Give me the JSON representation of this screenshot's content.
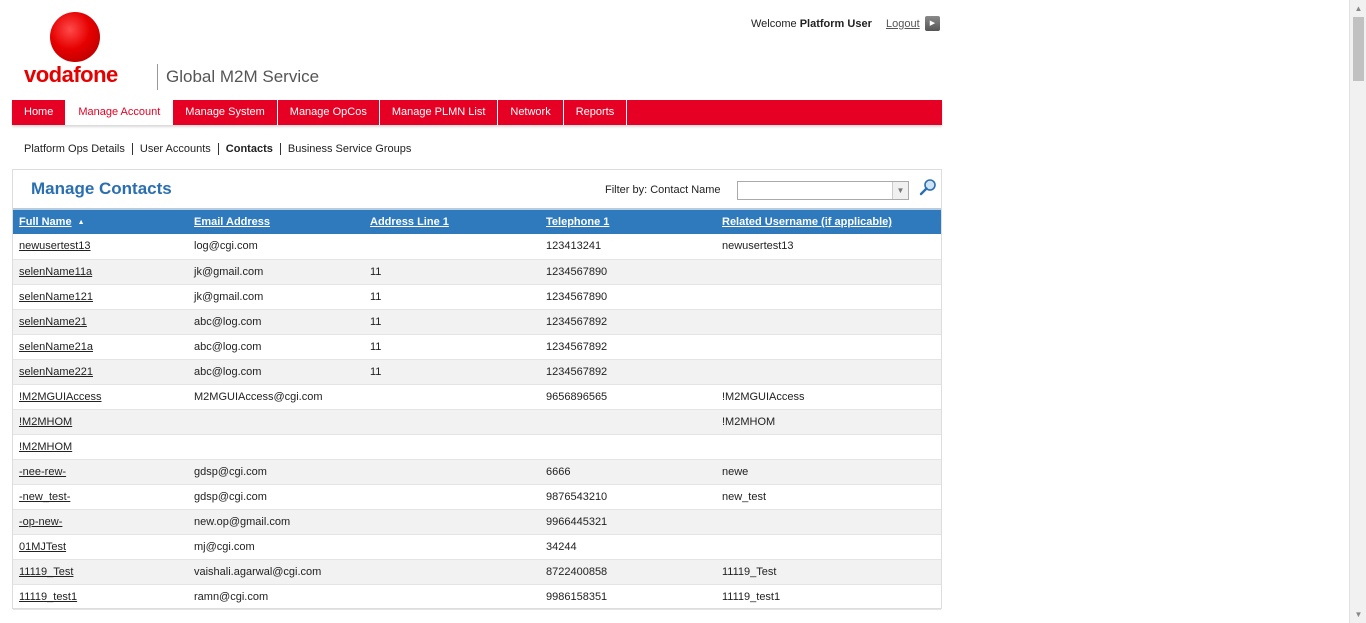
{
  "brand": {
    "name": "vodafone",
    "service": "Global M2M Service"
  },
  "header": {
    "welcome_prefix": "Welcome",
    "user": "Platform User",
    "logout": "Logout"
  },
  "nav": [
    {
      "label": "Home"
    },
    {
      "label": "Manage Account",
      "active": true
    },
    {
      "label": "Manage System"
    },
    {
      "label": "Manage OpCos"
    },
    {
      "label": "Manage PLMN List"
    },
    {
      "label": "Network"
    },
    {
      "label": "Reports"
    }
  ],
  "subnav": [
    {
      "label": "Platform Ops Details"
    },
    {
      "label": "User Accounts"
    },
    {
      "label": "Contacts",
      "active": true
    },
    {
      "label": "Business Service Groups"
    }
  ],
  "panel": {
    "title": "Manage Contacts",
    "filter_label": "Filter by: Contact Name",
    "filter_value": ""
  },
  "table": {
    "columns": [
      "Full Name",
      "Email Address",
      "Address Line 1",
      "Telephone 1",
      "Related Username (if applicable)"
    ],
    "rows": [
      [
        "newusertest13",
        "log@cgi.com",
        "",
        "123413241",
        "newusertest13"
      ],
      [
        "selenName11a",
        "jk@gmail.com",
        "11",
        "1234567890",
        ""
      ],
      [
        "selenName121",
        "jk@gmail.com",
        "11",
        "1234567890",
        ""
      ],
      [
        "selenName21",
        "abc@log.com",
        "11",
        "1234567892",
        ""
      ],
      [
        "selenName21a",
        "abc@log.com",
        "11",
        "1234567892",
        ""
      ],
      [
        "selenName221",
        "abc@log.com",
        "11",
        "1234567892",
        ""
      ],
      [
        "!M2MGUIAccess",
        "M2MGUIAccess@cgi.com",
        "",
        "9656896565",
        "!M2MGUIAccess"
      ],
      [
        "!M2MHOM",
        "",
        "",
        "",
        "!M2MHOM"
      ],
      [
        "!M2MHOM",
        "",
        "",
        "",
        ""
      ],
      [
        "-nee-rew-",
        "gdsp@cgi.com",
        "",
        "6666",
        "newe"
      ],
      [
        "-new_test-",
        "gdsp@cgi.com",
        "",
        "9876543210",
        "new_test"
      ],
      [
        "-op-new-",
        "new.op@gmail.com",
        "",
        "9966445321",
        ""
      ],
      [
        "01MJTest",
        "mj@cgi.com",
        "",
        "34244",
        ""
      ],
      [
        "11119_Test",
        "vaishali.agarwal@cgi.com",
        "",
        "8722400858",
        "11119_Test"
      ],
      [
        "11119_test1",
        "ramn@cgi.com",
        "",
        "9986158351",
        "11119_test1"
      ]
    ]
  },
  "colors": {
    "brand_red": "#e60023",
    "header_blue": "#2f7abd",
    "title_blue": "#2a6fb0"
  }
}
